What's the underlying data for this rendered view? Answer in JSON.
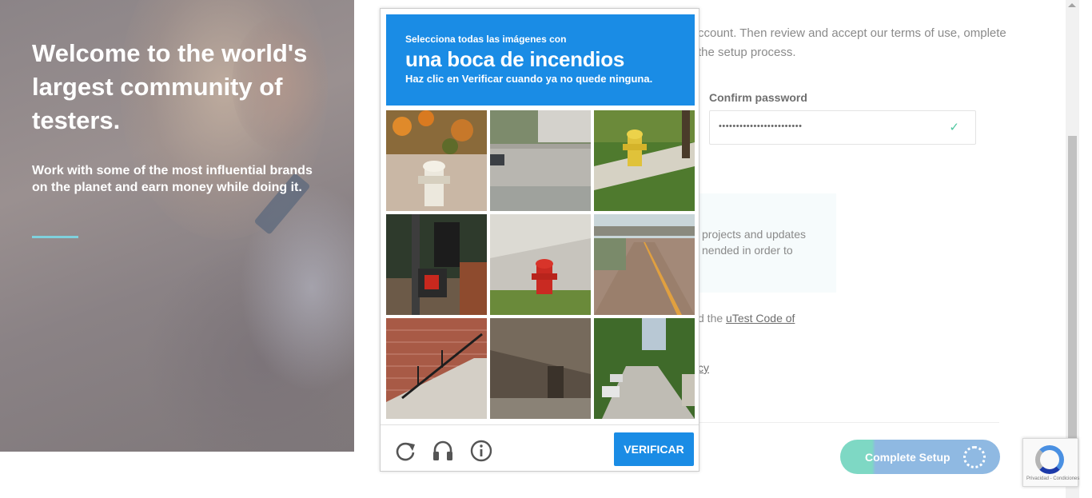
{
  "hero": {
    "title": "Welcome to the world's largest community of testers.",
    "subtitle": "Work with some of the most influential brands on the planet and earn money while doing it."
  },
  "form": {
    "intro": "ccount. Then review and accept our terms of use, omplete the setup process.",
    "confirm_password_label": "Confirm password",
    "confirm_password_value": "••••••••••••••••••••••••",
    "notice": "projects and updates nended in order to",
    "code_prefix": "d the ",
    "code_link": "uTest Code of",
    "privacy_link": "cy",
    "complete_button": "Complete Setup"
  },
  "captcha": {
    "instruction_small": "Selecciona todas las imágenes con",
    "instruction_big": "una boca de incendios",
    "instruction_hint": "Haz clic en Verificar cuando ya no quede ninguna.",
    "verify_button": "VERIFICAR",
    "tiles": [
      "fire-hydrant-tile",
      "street-tile",
      "fire-hydrant-tile",
      "traffic-light-tile",
      "fire-hydrant-tile",
      "highway-tile",
      "stairs-tile",
      "bridge-tile",
      "tree-street-tile"
    ]
  },
  "recaptcha_badge": {
    "terms": "Privacidad - Condiciones"
  },
  "colors": {
    "captcha_blue": "#1a8ce5",
    "accent_teal": "#7ed8c4",
    "check_green": "#4fc7a0"
  }
}
